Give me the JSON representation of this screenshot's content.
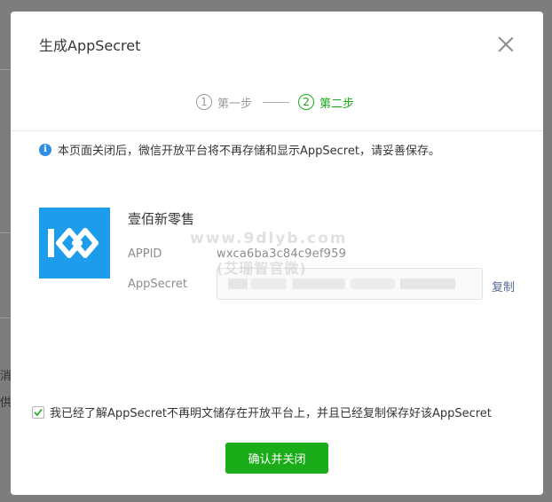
{
  "background": {
    "fragment_1": "消",
    "fragment_2": "供"
  },
  "dialog": {
    "title": "生成AppSecret",
    "steps": [
      {
        "num": "1",
        "label": "第一步",
        "state": "done"
      },
      {
        "num": "2",
        "label": "第二步",
        "state": "active"
      }
    ],
    "notice": "本页面关闭后，微信开放平台将不再存储和显示AppSecret，请妥善保存。",
    "notice_icon": "info-icon",
    "app": {
      "name": "壹佰新零售",
      "appid_label": "APPID",
      "appid_value": "wxca6ba3c84c9ef959",
      "secret_label": "AppSecret",
      "copy_label": "复制"
    },
    "watermark": {
      "line1": "www.9dlyb.com",
      "line2": "(艾珊智官微)"
    },
    "agreement": {
      "checked": true,
      "text": "我已经了解AppSecret不再明文储存在开放平台上，并且已经复制保存好该AppSecret"
    },
    "confirm_label": "确认并关闭"
  },
  "colors": {
    "accent": "#1aad19",
    "link": "#576b95",
    "info": "#2e8ee6",
    "logo_bg": "#1c9cea"
  }
}
